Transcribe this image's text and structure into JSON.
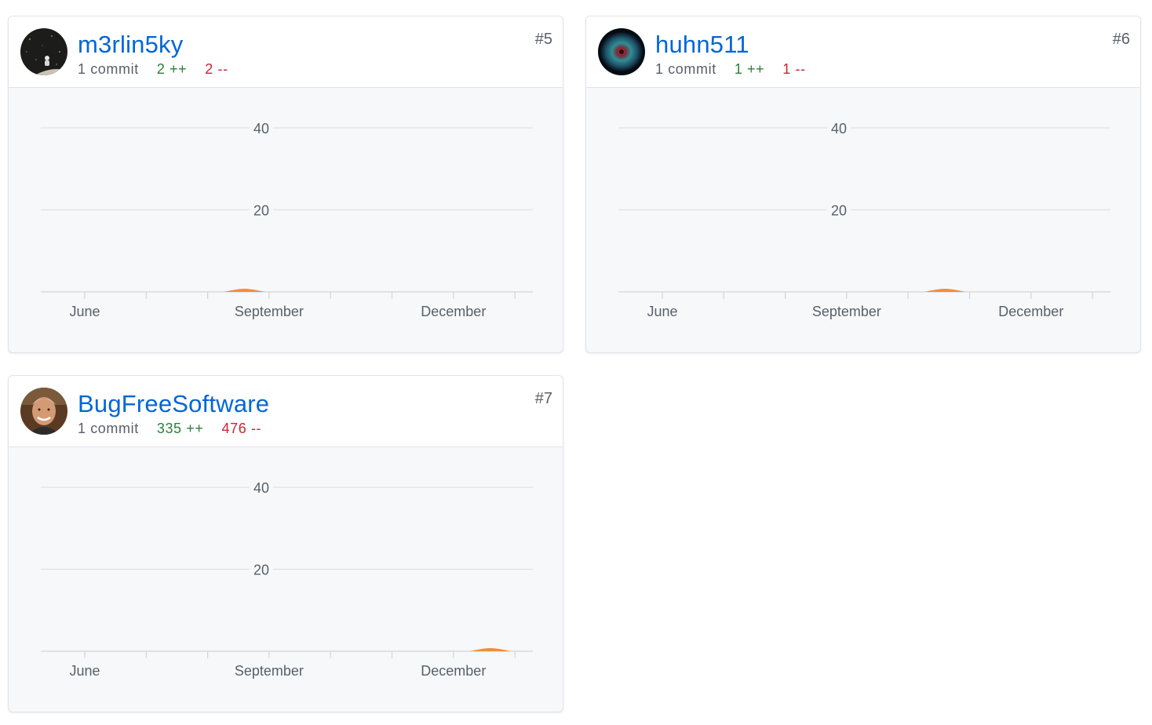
{
  "contributors": [
    {
      "username": "m3rlin5ky",
      "rank": "#5",
      "commits": "1 commit",
      "additions": "2 ++",
      "deletions": "2 --",
      "avatar_icon": "space-astronaut-avatar",
      "bump_month_position": 5.6
    },
    {
      "username": "huhn511",
      "rank": "#6",
      "commits": "1 commit",
      "additions": "1 ++",
      "deletions": "1 --",
      "avatar_icon": "nebula-eye-avatar",
      "bump_month_position": 7.6
    },
    {
      "username": "BugFreeSoftware",
      "rank": "#7",
      "commits": "1 commit",
      "additions": "335 ++",
      "deletions": "476 --",
      "avatar_icon": "person-photo-avatar",
      "bump_month_position": 9.6
    }
  ],
  "chart_data": {
    "type": "area",
    "y_ticks": [
      "40",
      "20"
    ],
    "y_tick_values": [
      40,
      20
    ],
    "ylim": [
      0,
      40
    ],
    "x_tick_labels": [
      "June",
      "September",
      "December"
    ],
    "x_tick_label_months": [
      3,
      6,
      9
    ],
    "x_months_total": 11,
    "grid": true,
    "fill_color": "#f58b3c"
  }
}
